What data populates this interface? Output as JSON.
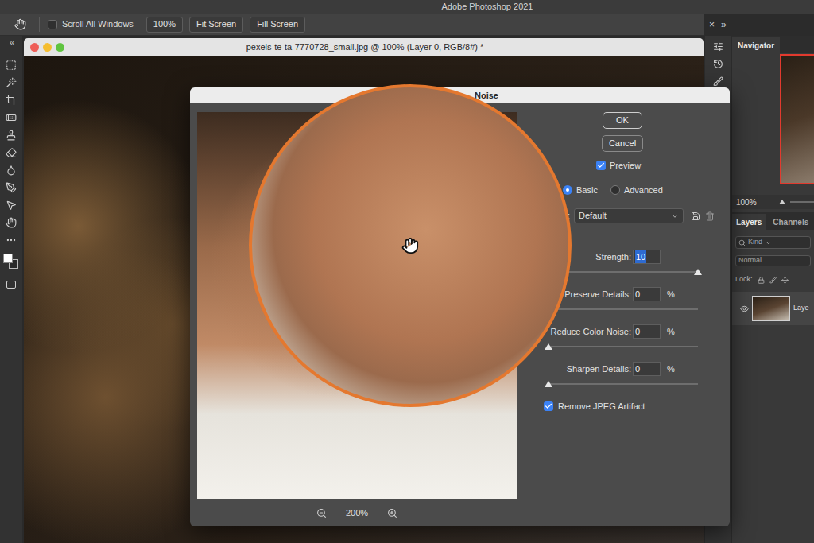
{
  "app": {
    "title": "Adobe Photoshop 2021"
  },
  "options_bar": {
    "scroll_all_windows": {
      "label": "Scroll All Windows",
      "checked": false
    },
    "buttons": [
      "100%",
      "Fit Screen",
      "Fill Screen"
    ]
  },
  "toolbar": {
    "collapse_glyph": "«"
  },
  "document": {
    "title": "pexels-te-ta-7770728_small.jpg @ 100% (Layer 0, RGB/8#) *"
  },
  "dialog": {
    "title": "Noise",
    "buttons": [
      "OK",
      "Cancel"
    ],
    "preview": {
      "label": "Preview",
      "checked": true
    },
    "modes": [
      {
        "label": "Basic",
        "selected": true
      },
      {
        "label": "Advanced",
        "selected": false
      }
    ],
    "settings": {
      "label": ":",
      "value": "Default"
    },
    "sliders": [
      {
        "label": "Strength:",
        "value": "10",
        "unit": "",
        "level": 1,
        "value_selected": true
      },
      {
        "label": "Preserve Details:",
        "value": "0",
        "unit": "%",
        "level": 0,
        "value_selected": false
      },
      {
        "label": "Reduce Color Noise:",
        "value": "0",
        "unit": "%",
        "level": 0,
        "value_selected": false
      },
      {
        "label": "Sharpen Details:",
        "value": "0",
        "unit": "%",
        "level": 0,
        "value_selected": false
      }
    ],
    "remove_jpeg_artifact": {
      "label": "Remove JPEG Artifact",
      "checked": true
    },
    "zoom": "200%"
  },
  "dock": {
    "close_glyph": "×",
    "collapse_glyph": "»"
  },
  "navigator": {
    "title": "Navigator",
    "zoom": "100%"
  },
  "layers_panel": {
    "tabs": [
      {
        "label": "Layers",
        "selected": true
      },
      {
        "label": "Channels",
        "selected": false
      }
    ],
    "search_placeholder": "Kind",
    "blend_mode": "Normal",
    "lock_label": "Lock:",
    "layers": [
      {
        "name": "Laye",
        "visible": true
      }
    ]
  }
}
